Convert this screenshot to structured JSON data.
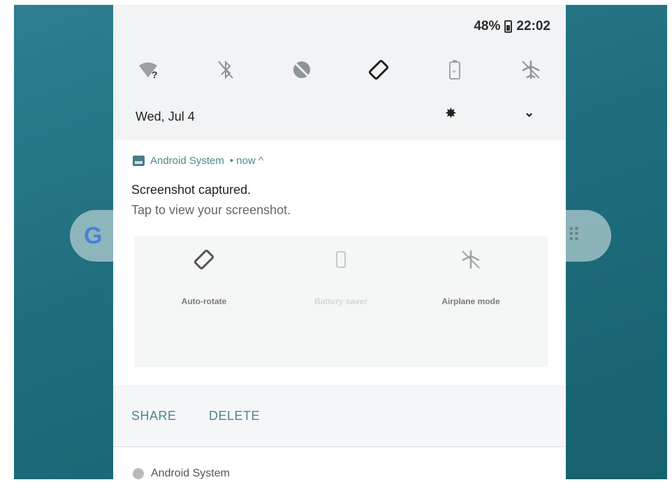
{
  "status_bar": {
    "battery": "48%",
    "time": "22:02"
  },
  "quick_settings": {
    "tiles": [
      {
        "name": "wifi-unknown-icon"
      },
      {
        "name": "bluetooth-off-icon"
      },
      {
        "name": "dnd-off-icon"
      },
      {
        "name": "auto-rotate-icon"
      },
      {
        "name": "battery-saver-icon"
      },
      {
        "name": "airplane-mode-icon"
      }
    ],
    "date": "Wed, Jul 4"
  },
  "notification": {
    "app_name": "Android System",
    "meta": "• now ^",
    "title": "Screenshot captured.",
    "subtitle": "Tap to view your screenshot.",
    "preview_tiles": [
      {
        "label": "Auto-rotate"
      },
      {
        "label": "Battery saver"
      },
      {
        "label": "Airplane mode"
      }
    ],
    "actions": {
      "share": "SHARE",
      "delete": "DELETE"
    }
  },
  "notification2": {
    "app_name": "Android System"
  },
  "colors": {
    "accent": "#4e8598",
    "wallpaper": "#1f6e7e"
  }
}
